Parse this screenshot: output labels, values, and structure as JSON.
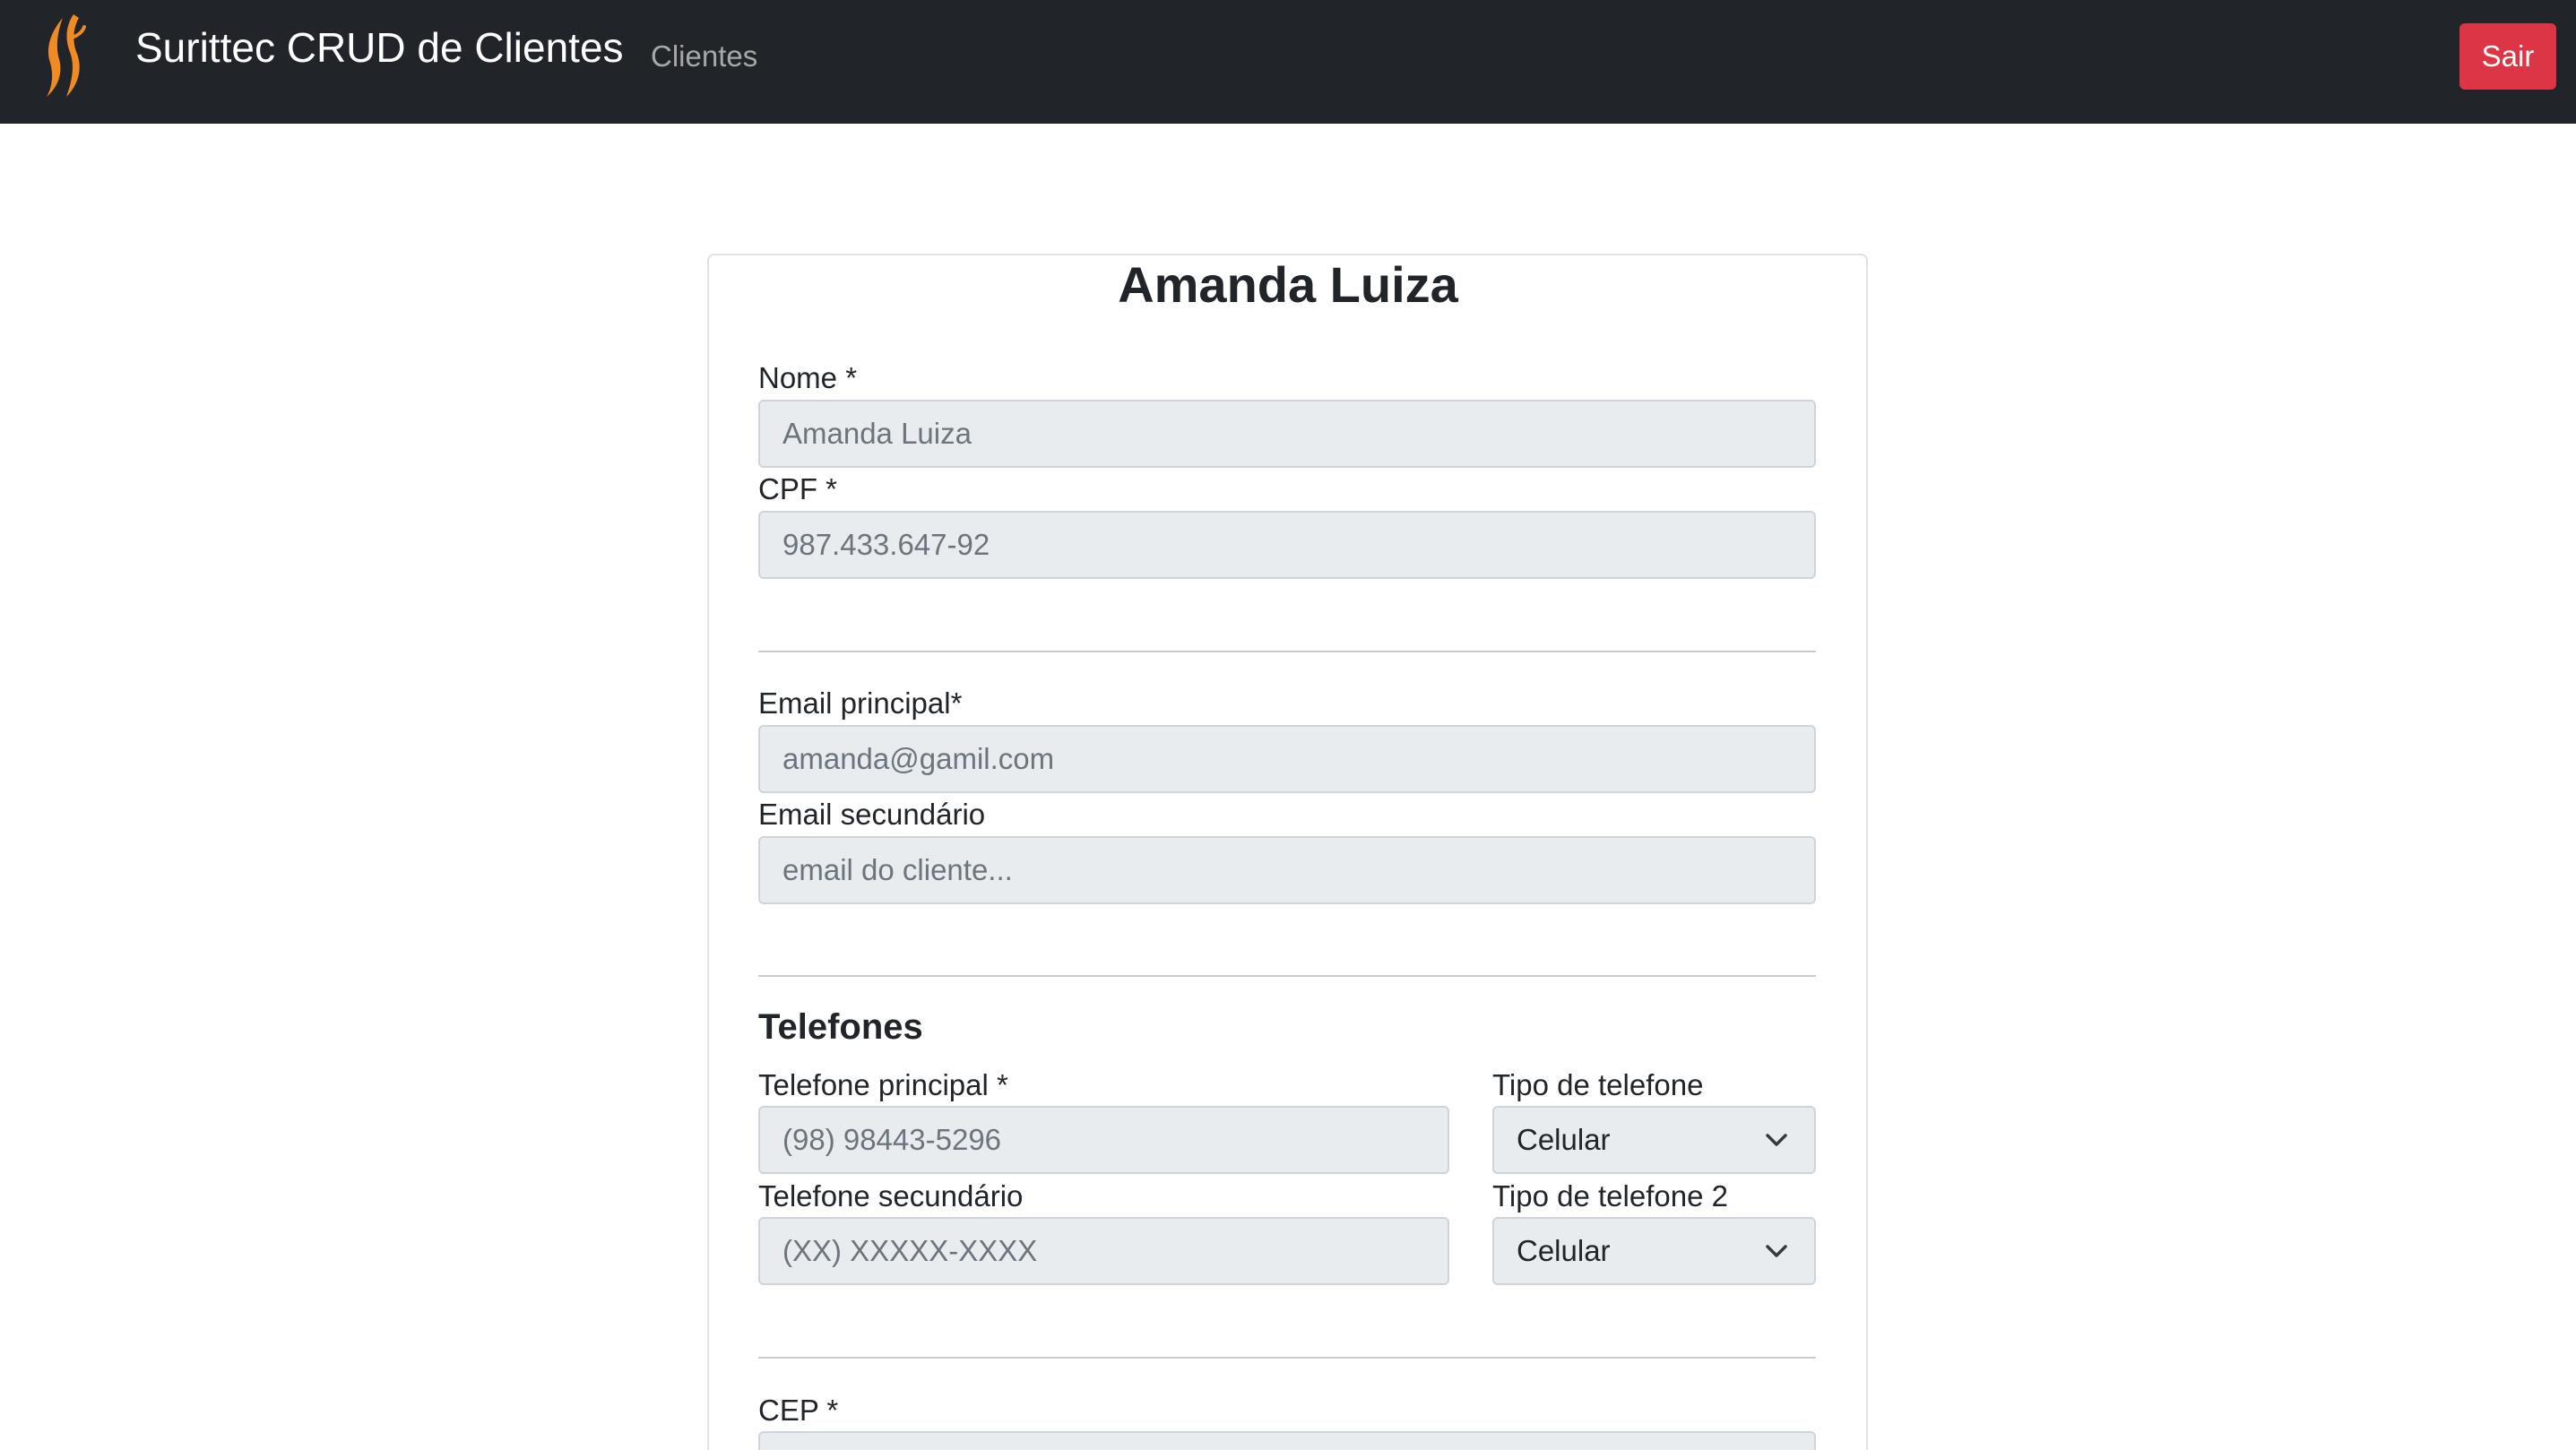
{
  "navbar": {
    "brand": "Surittec CRUD de Clientes",
    "subtitle": "Clientes",
    "logout_label": "Sair",
    "logo_icon": "flame-logo-icon"
  },
  "form": {
    "title": "Amanda Luiza",
    "nome": {
      "label": "Nome *",
      "value": "Amanda Luiza"
    },
    "cpf": {
      "label": "CPF *",
      "value": "987.433.647-92"
    },
    "email_principal": {
      "label": "Email principal*",
      "value": "amanda@gamil.com"
    },
    "email_secundario": {
      "label": "Email secundário",
      "placeholder": "email do cliente..."
    },
    "telefones_title": "Telefones",
    "telefone_principal": {
      "label": "Telefone principal *",
      "value": "(98) 98443-5296"
    },
    "tipo_telefone": {
      "label": "Tipo de telefone",
      "selected": "Celular"
    },
    "telefone_secundario": {
      "label": "Telefone secundário",
      "placeholder": "(XX) XXXXX-XXXX"
    },
    "tipo_telefone_2": {
      "label": "Tipo de telefone 2",
      "selected": "Celular"
    },
    "cep": {
      "label": "CEP *"
    }
  },
  "colors": {
    "navbar_bg": "#212529",
    "danger": "#dc3545",
    "input_bg": "#e9ecef",
    "logo_orange": "#f08a24"
  }
}
